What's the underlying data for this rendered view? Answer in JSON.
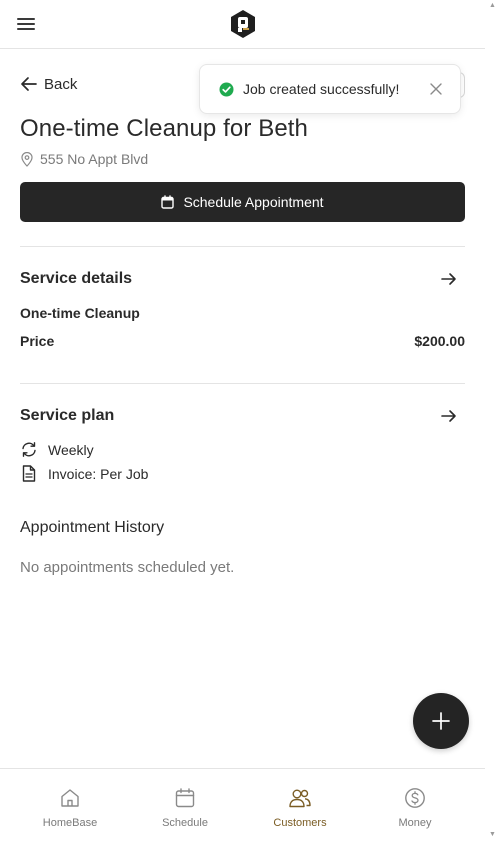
{
  "header": {
    "menu_icon": "hamburger-icon",
    "logo_icon": "brand-logo-icon"
  },
  "back": {
    "label": "Back",
    "icon": "arrow-left-icon"
  },
  "toast": {
    "message": "Job created successfully!",
    "icon": "check-circle-icon",
    "close_icon": "close-icon"
  },
  "job": {
    "title": "One-time Cleanup for Beth",
    "address": "555 No Appt Blvd",
    "schedule_button": "Schedule Appointment"
  },
  "service_details": {
    "title": "Service details",
    "service_name": "One-time Cleanup",
    "price_label": "Price",
    "price_value": "$200.00"
  },
  "service_plan": {
    "title": "Service plan",
    "frequency": "Weekly",
    "invoice": "Invoice: Per Job"
  },
  "history": {
    "title": "Appointment History",
    "empty": "No appointments scheduled yet."
  },
  "bottom_nav": {
    "items": [
      {
        "label": "HomeBase",
        "icon": "home-icon"
      },
      {
        "label": "Schedule",
        "icon": "calendar-icon"
      },
      {
        "label": "Customers",
        "icon": "users-icon"
      },
      {
        "label": "Money",
        "icon": "dollar-circle-icon"
      }
    ],
    "active": "Customers"
  },
  "colors": {
    "primary": "#262626",
    "active_nav": "#7a5c24",
    "success": "#1faa4f",
    "muted": "#7a7a7a"
  }
}
